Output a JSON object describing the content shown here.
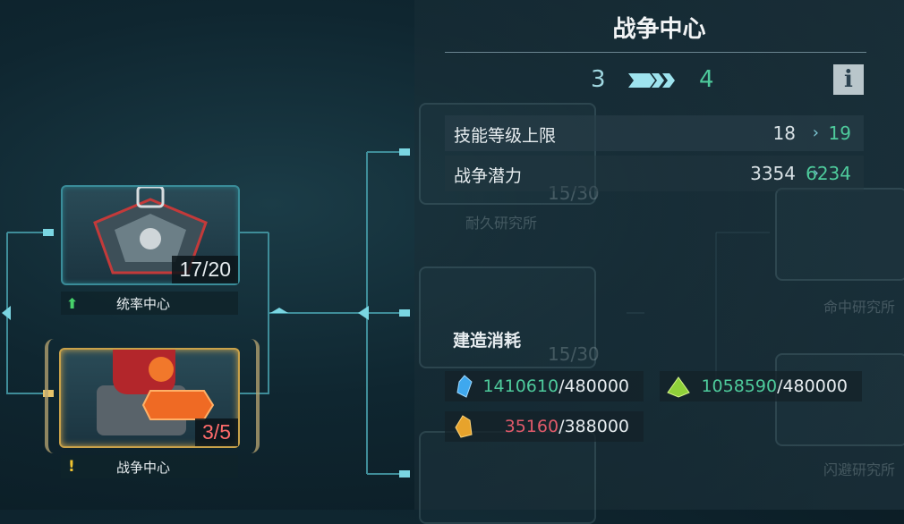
{
  "panel": {
    "title": "战争中心",
    "level_from": "3",
    "level_to": "4",
    "info_label": "i",
    "stats": [
      {
        "label": "技能等级上限",
        "from": "18",
        "to": "19"
      },
      {
        "label": "战争潜力",
        "from": "3354",
        "to": "6234"
      }
    ],
    "build_cost_title": "建造消耗",
    "resources": [
      {
        "icon": "blue-crystal-icon",
        "have": "1410610",
        "need": "/480000"
      },
      {
        "icon": "green-pyramid-icon",
        "have": "1058590",
        "need": "/480000"
      },
      {
        "icon": "gold-crystal-icon",
        "have": "35160",
        "need": "/388000"
      }
    ]
  },
  "buildings": [
    {
      "name": "统率中心",
      "level": "17/20",
      "status_icon": "green-up-arrow-icon"
    },
    {
      "name": "战争中心",
      "level": "3/5",
      "status_icon": "yellow-exclamation-icon"
    }
  ],
  "background_nodes": [
    {
      "name": "耐久研究所",
      "level": "15/30"
    },
    {
      "name": "",
      "level": "15/30"
    },
    {
      "name": "命中研究所"
    },
    {
      "name": "闪避研究所"
    }
  ],
  "colors": {
    "accent_teal": "#4fb8c4",
    "green": "#4ecb9c",
    "red": "#e05a6a",
    "gold": "#c9a24a"
  }
}
